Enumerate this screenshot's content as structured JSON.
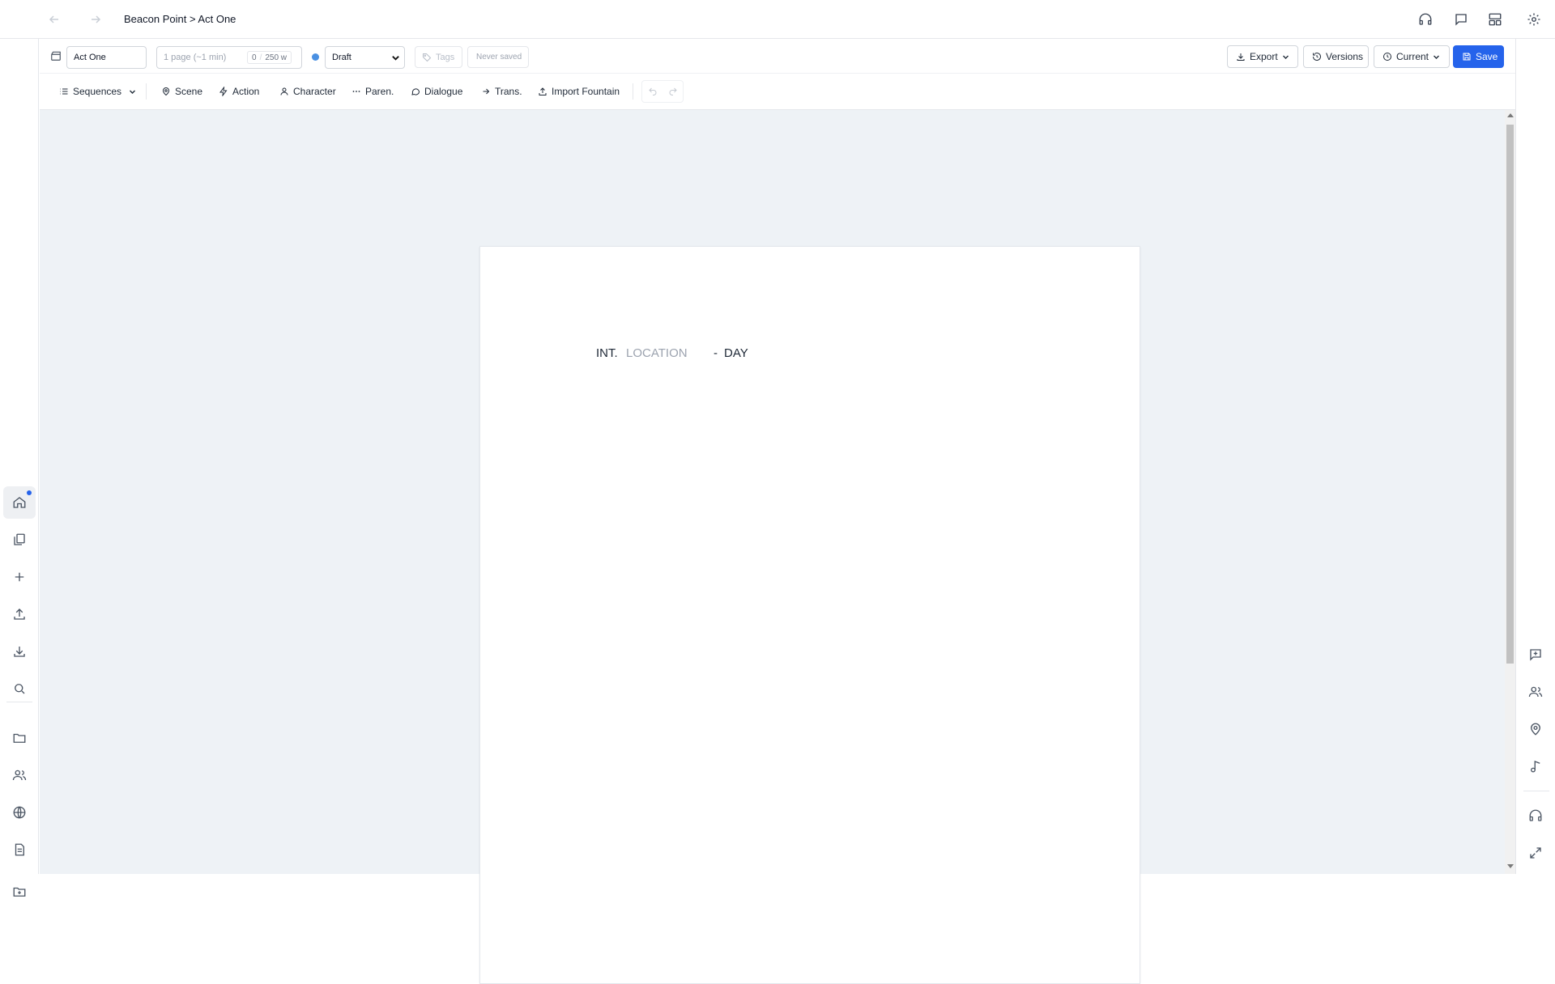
{
  "breadcrumb": {
    "text": "Beacon Point > Act One"
  },
  "doc": {
    "title_value": "Act One",
    "page_info": "1 page (~1 min)",
    "word_count": "0",
    "word_target": "250 w",
    "status": "Draft",
    "tags_placeholder": "Tags",
    "save_state": "Never saved"
  },
  "actions": {
    "export": "Export",
    "versions": "Versions",
    "current": "Current",
    "save": "Save"
  },
  "tools": {
    "sequences": "Sequences",
    "scene": "Scene",
    "action": "Action",
    "character": "Character",
    "paren": "Paren.",
    "dialogue": "Dialogue",
    "trans": "Trans.",
    "import": "Import Fountain"
  },
  "scene_heading": {
    "prefix": "INT.",
    "location": "LOCATION",
    "dash": "-",
    "time": "DAY"
  },
  "colors": {
    "accent": "#2563eb",
    "status_dot": "#4a90e2"
  }
}
